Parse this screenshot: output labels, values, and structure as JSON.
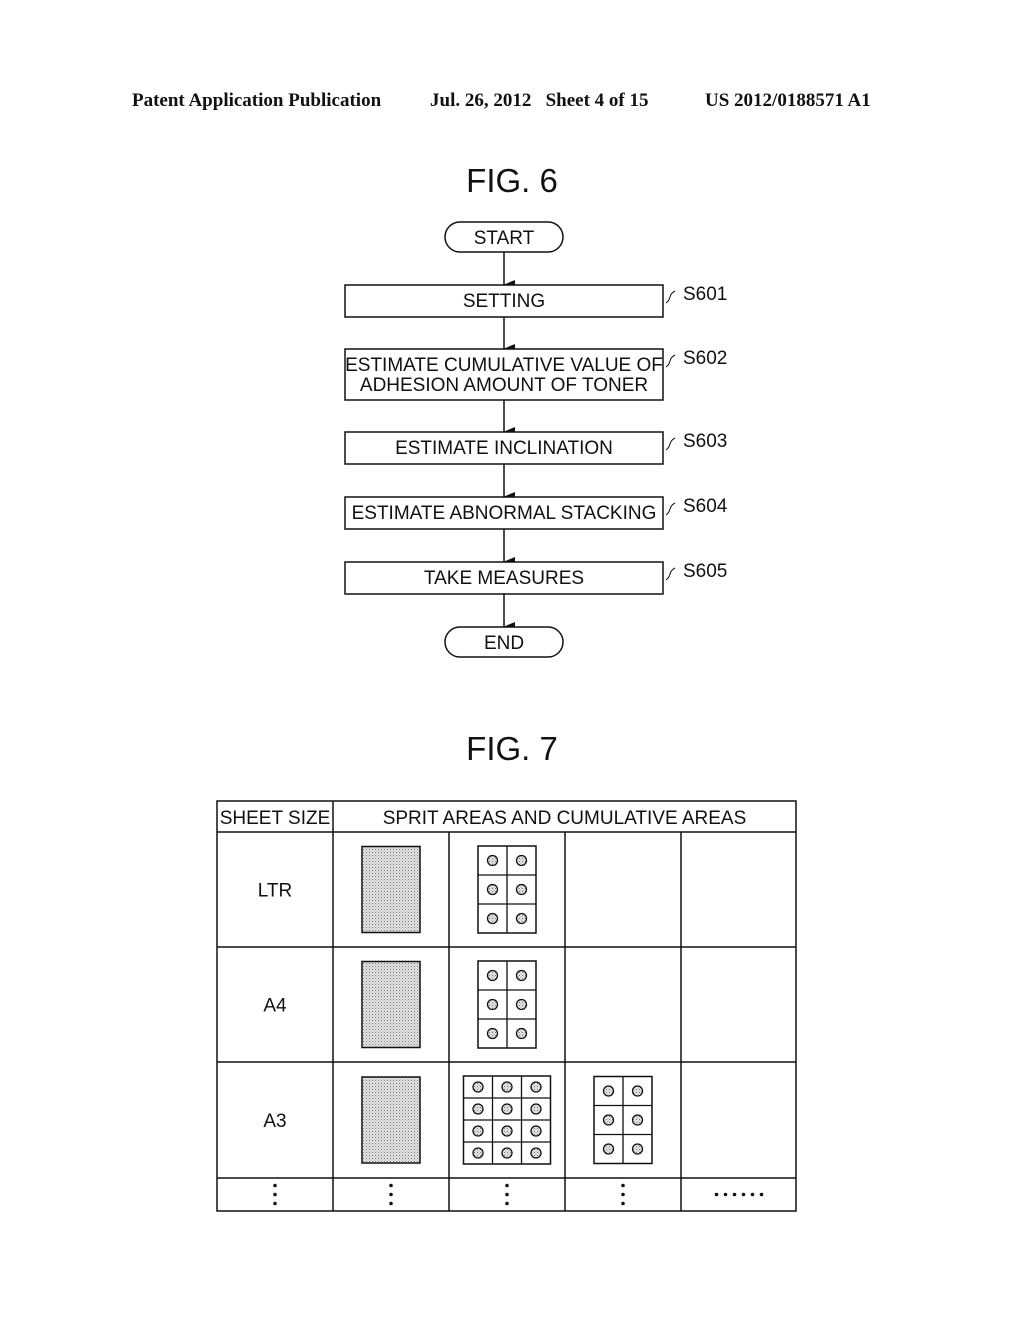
{
  "header": {
    "left": "Patent Application Publication",
    "date_sheet": "Jul. 26, 2012   Sheet 4 of 15",
    "number": "US 2012/0188571 A1"
  },
  "fig6": {
    "title": "FIG. 6",
    "start": "START",
    "end": "END",
    "steps": [
      {
        "id": "S601",
        "lines": [
          "SETTING"
        ]
      },
      {
        "id": "S602",
        "lines": [
          "ESTIMATE CUMULATIVE VALUE OF",
          "ADHESION AMOUNT OF TONER"
        ]
      },
      {
        "id": "S603",
        "lines": [
          "ESTIMATE INCLINATION"
        ]
      },
      {
        "id": "S604",
        "lines": [
          "ESTIMATE ABNORMAL STACKING"
        ]
      },
      {
        "id": "S605",
        "lines": [
          "TAKE MEASURES"
        ]
      }
    ]
  },
  "fig7": {
    "title": "FIG. 7",
    "headers": [
      "SHEET SIZE",
      "SPRIT AREAS AND CUMULATIVE AREAS"
    ],
    "rows": [
      {
        "size": "LTR",
        "cells": [
          {
            "type": "solid"
          },
          {
            "type": "grid",
            "cols": 2,
            "rows": 3
          },
          {
            "type": "empty"
          },
          {
            "type": "empty"
          }
        ]
      },
      {
        "size": "A4",
        "cells": [
          {
            "type": "solid"
          },
          {
            "type": "grid",
            "cols": 2,
            "rows": 3
          },
          {
            "type": "empty"
          },
          {
            "type": "empty"
          }
        ]
      },
      {
        "size": "A3",
        "cells": [
          {
            "type": "solid"
          },
          {
            "type": "grid",
            "cols": 3,
            "rows": 4
          },
          {
            "type": "grid",
            "cols": 2,
            "rows": 3
          },
          {
            "type": "empty"
          }
        ]
      }
    ],
    "continuation_vertical": "⋮",
    "continuation_horizontal": "••••••"
  }
}
